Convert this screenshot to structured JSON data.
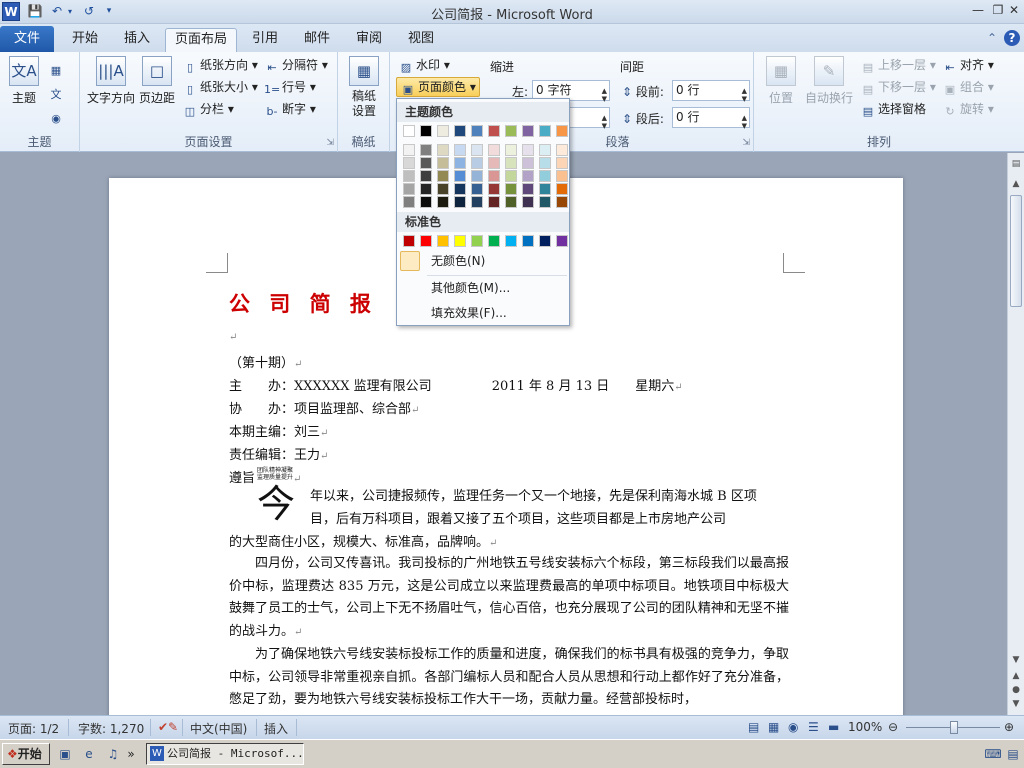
{
  "window": {
    "title": "公司简报 - Microsoft Word",
    "app_icon": "W"
  },
  "tabs": {
    "file": "文件",
    "items": [
      "开始",
      "插入",
      "页面布局",
      "引用",
      "邮件",
      "审阅",
      "视图"
    ],
    "active": "页面布局"
  },
  "ribbon": {
    "theme": {
      "label": "主题",
      "themes_btn": "主题",
      "group_label": "主题"
    },
    "page_setup": {
      "group_label": "页面设置",
      "text_direction": "文字方向",
      "margins": "页边距",
      "orientation": "纸张方向",
      "size": "纸张大小",
      "columns": "分栏",
      "breaks": "分隔符",
      "line_numbers": "行号",
      "hyphenation": "断字"
    },
    "draft": {
      "group_label": "稿纸",
      "btn": "稿纸\n设置",
      "line1": "稿纸",
      "line2": "设置"
    },
    "page_background": {
      "watermark": "水印",
      "page_color": "页面颜色"
    },
    "paragraph": {
      "group_label": "段落",
      "indent_label": "缩进",
      "indent_left_label": "左:",
      "indent_left_value": "0 字符",
      "spacing_label": "间距",
      "before_label": "段前:",
      "before_value": "0 行",
      "after_label": "段后:",
      "after_value": "0 行"
    },
    "arrange": {
      "group_label": "排列",
      "position": "位置",
      "wrap": "自动换行",
      "bring_forward": "上移一层",
      "send_backward": "下移一层",
      "selection_pane": "选择窗格",
      "align": "对齐",
      "group": "组合",
      "rotate": "旋转"
    }
  },
  "color_popup": {
    "theme_colors_label": "主题颜色",
    "standard_colors_label": "标准色",
    "no_color": "无颜色(N)",
    "more_colors": "其他颜色(M)...",
    "fill_effects": "填充效果(F)...",
    "theme_colors": [
      [
        "#ffffff",
        "#f2f2f2",
        "#d8d8d8",
        "#bfbfbf",
        "#a5a5a5",
        "#7f7f7f"
      ],
      [
        "#000000",
        "#7f7f7f",
        "#595959",
        "#3f3f3f",
        "#262626",
        "#0c0c0c"
      ],
      [
        "#eeece1",
        "#ddd9c3",
        "#c4bd97",
        "#938953",
        "#494429",
        "#1d1b10"
      ],
      [
        "#1f497d",
        "#c6d9f0",
        "#8db3e2",
        "#548dd4",
        "#17365d",
        "#0f243e"
      ],
      [
        "#4f81bd",
        "#dbe5f1",
        "#b8cce4",
        "#95b3d7",
        "#366092",
        "#244061"
      ],
      [
        "#c0504d",
        "#f2dcdb",
        "#e5b9b7",
        "#d99694",
        "#953734",
        "#632423"
      ],
      [
        "#9bbb59",
        "#ebf1dd",
        "#d7e3bc",
        "#c3d69b",
        "#76923c",
        "#4f6128"
      ],
      [
        "#8064a2",
        "#e5e0ec",
        "#ccc1d9",
        "#b2a2c7",
        "#5f497a",
        "#3f3151"
      ],
      [
        "#4bacc6",
        "#dbeef3",
        "#b7dde8",
        "#92cddc",
        "#31859b",
        "#205867"
      ],
      [
        "#f79646",
        "#fdeada",
        "#fbd5b5",
        "#fac08f",
        "#e36c09",
        "#974806"
      ]
    ],
    "standard_colors": [
      "#c00000",
      "#ff0000",
      "#ffc000",
      "#ffff00",
      "#92d050",
      "#00b050",
      "#00b0f0",
      "#0070c0",
      "#002060",
      "#7030a0"
    ]
  },
  "document": {
    "title": "公 司 简 报",
    "title_color": "#cc0000",
    "issue": "（第十期）",
    "host_label": "主　　办：",
    "host": "XXXXXX 监理有限公司",
    "date": "2011 年 8 月 13 日",
    "weekday": "星期六",
    "cohost_label": "协　　办：",
    "cohost": "项目监理部、综合部",
    "editor_in_chief": "本期主编：刘三",
    "editor": "责任编辑：王力",
    "tenet_label": "遵旨",
    "tenet_line1": "团队精神凝聚",
    "tenet_line2": "监理质量提升",
    "dropcap": "今",
    "para1_first": "年以来，公司捷报频传，监理任务一个又一个地接，先是保利南海水城 B 区项目，后有万科项目，跟着又接了五个项目，这些项目都是上市房地产公司的大型商住小区，规模大、标准高，品牌响。",
    "para1_line1": "年以来，公司捷报频传，监理任务一个又一个地接，先是保利南海水城 B 区项",
    "para1_line2": "目，后有万科项目，跟着又接了五个项目，这些项目都是上市房地产公司",
    "para1_line3": "的大型商住小区，规模大、标准高，品牌响。",
    "para2": "四月份，公司又传喜讯。我司投标的广州地铁五号线安装标六个标段，第三标段我们以最高报价中标，监理费达 835 万元，这是公司成立以来监理费最高的单项中标项目。地铁项目中标极大鼓舞了员工的士气，公司上下无不扬眉吐气，信心百倍，也充分展现了公司的团队精神和无坚不摧的战斗力。",
    "para3": "为了确保地铁六号线安装标投标工作的质量和进度，确保我们的标书具有极强的竞争力，争取中标，公司领导非常重视亲自抓。各部门编标人员和配合人员从思想和行动上都作好了充分准备，憋足了劲，要为地铁六号线安装标投标工作大干一场，贡献力量。经营部投标时，"
  },
  "status": {
    "page": "页面: 1/2",
    "words": "字数: 1,270",
    "language": "中文(中国)",
    "insert_mode": "插入",
    "zoom": "100%"
  },
  "taskbar": {
    "start": "开始",
    "task_word": "公司简报 - Microsof..."
  }
}
